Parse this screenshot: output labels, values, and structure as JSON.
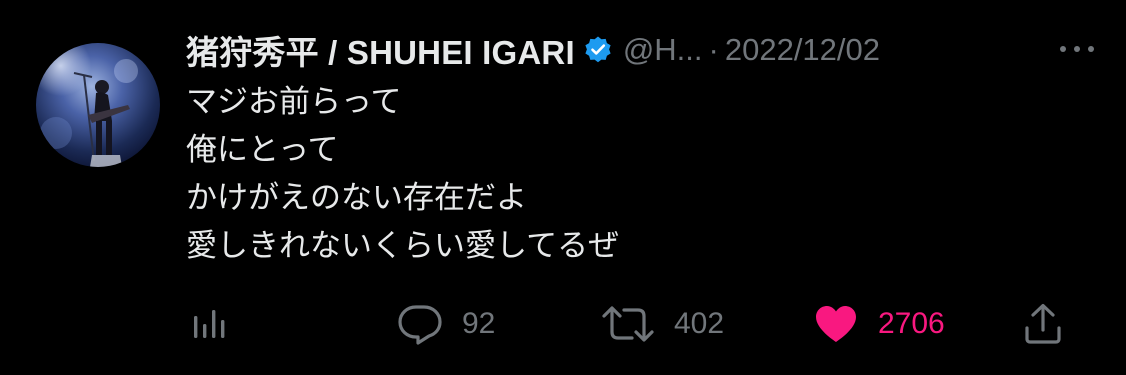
{
  "tweet": {
    "author": {
      "display_name": "猪狩秀平 / SHUHEI IGARI",
      "handle": "@H...",
      "verified": true,
      "avatar_icon": "avatar-guitarist-photo"
    },
    "separator": "·",
    "date": "2022/12/02",
    "more_icon": "more-dots-icon",
    "lines": [
      "マジお前らって",
      "俺にとって",
      "かけがえのない存在だよ",
      "愛しきれないくらい愛してるぜ"
    ],
    "actions": {
      "views_icon": "analytics-icon",
      "reply_icon": "reply-icon",
      "reply_count": "92",
      "retweet_icon": "retweet-icon",
      "retweet_count": "402",
      "like_icon": "heart-icon",
      "like_count": "2706",
      "share_icon": "share-icon"
    },
    "colors": {
      "background": "#000000",
      "text": "#e7e9ea",
      "muted": "#71767b",
      "verified": "#1d9bf0",
      "like": "#f91880"
    }
  }
}
